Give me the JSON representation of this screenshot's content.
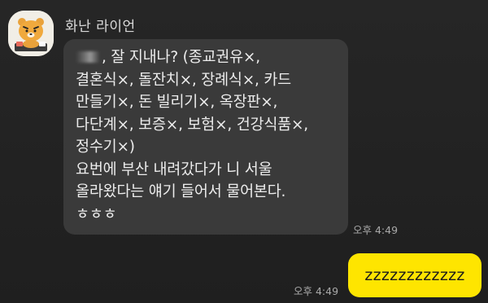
{
  "chat": {
    "sender": {
      "name": "화난 라이언",
      "avatar_icon": "angry-ryan-character"
    },
    "incoming_message": {
      "lines": [
        ", 잘 지내나? (종교권유×,",
        "결혼식×, 돌잔치×, 장례식×, 카드",
        "만들기×, 돈 빌리기×, 옥장판×,",
        "다단계×, 보증×, 보험×, 건강식품×,",
        "정수기×)",
        "요번에 부산 내려갔다가 니 서울",
        "올라왔다는 얘기 들어서 물어본다.",
        "ㅎㅎㅎ"
      ],
      "time": "오후 4:49"
    },
    "outgoing_message": {
      "text": "zzzzzzzzzzzz",
      "time": "오후 4:49"
    }
  },
  "colors": {
    "background": "#232323",
    "incoming_bubble": "#3a3a3a",
    "outgoing_bubble": "#fee500",
    "timestamp": "#a9a9a9"
  }
}
